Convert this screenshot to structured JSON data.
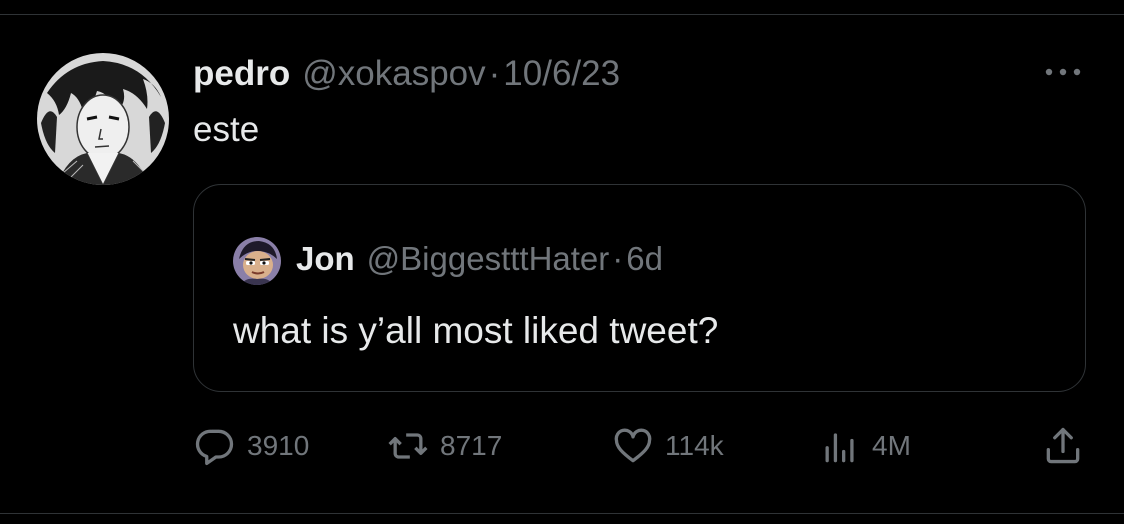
{
  "post": {
    "author": {
      "display_name": "pedro",
      "handle": "@xokaspov",
      "avatar_icon": "anime-portrait-avatar"
    },
    "separator": "·",
    "date": "10/6/23",
    "text": "este",
    "more_icon": "more-horizontal-icon"
  },
  "quote": {
    "author": {
      "display_name": "Jon",
      "handle": "@BiggestttHater",
      "avatar_icon": "cartoon-avatar"
    },
    "separator": "·",
    "time": "6d",
    "text": "what is y’all most liked tweet?"
  },
  "actions": {
    "reply": {
      "icon": "reply-bubble-icon",
      "count": "3910"
    },
    "retweet": {
      "icon": "retweet-icon",
      "count": "8717"
    },
    "like": {
      "icon": "heart-icon",
      "count": "114k"
    },
    "views": {
      "icon": "views-bar-chart-icon",
      "count": "4M"
    },
    "share": {
      "icon": "share-icon"
    }
  },
  "colors": {
    "background": "#000000",
    "primary_text": "#e7e9ea",
    "secondary_text": "#71767b",
    "border": "#2f3336"
  }
}
